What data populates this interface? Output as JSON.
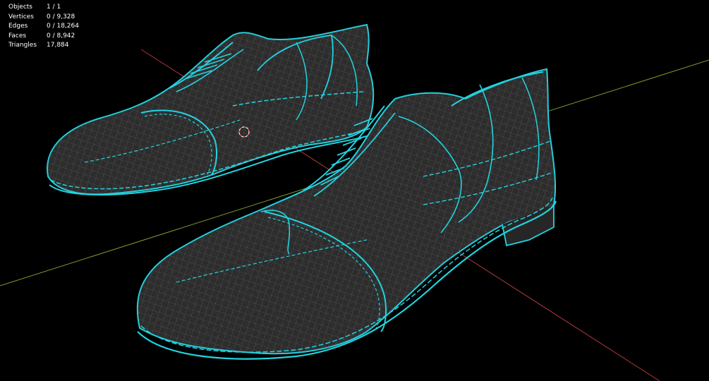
{
  "viewport": {
    "name": "3D Viewport",
    "background": "#000000",
    "mode": "wireframe"
  },
  "stats": [
    {
      "label": "Objects",
      "value": "1 / 1"
    },
    {
      "label": "Vertices",
      "value": "0 / 9,328"
    },
    {
      "label": "Edges",
      "value": "0 / 18,264"
    },
    {
      "label": "Faces",
      "value": "0 / 8,942"
    },
    {
      "label": "Triangles",
      "value": "17,884"
    }
  ],
  "colors": {
    "x_axis": "#b0383a",
    "y_axis": "#7e9a2c",
    "mesh_fill": "#2c2c2c",
    "wire": "#6a6a6a",
    "selected_edges": "#22d3e0",
    "cursor_red": "#ff5a4a",
    "cursor_white": "#ffffff"
  },
  "icons": {
    "cursor": "3d-cursor-icon"
  }
}
